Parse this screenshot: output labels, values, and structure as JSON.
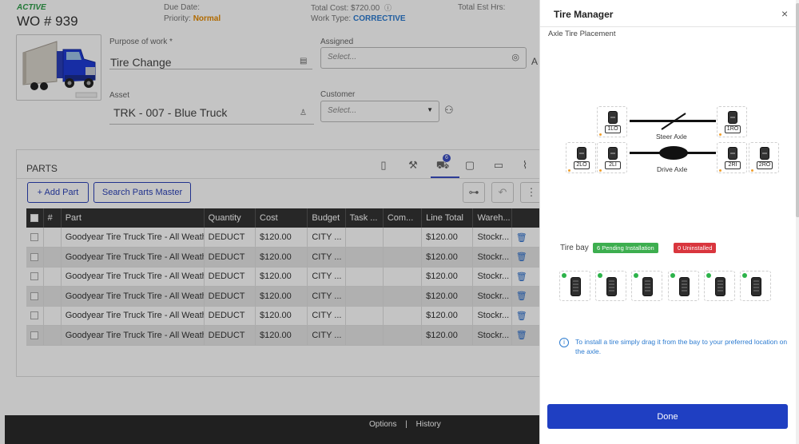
{
  "work_order": {
    "status": "ACTIVE",
    "number": "WO # 939",
    "due_date_label": "Due Date:",
    "priority_label": "Priority:",
    "priority_value": "Normal",
    "total_cost_label": "Total Cost:",
    "total_cost_value": "$720.00",
    "work_type_label": "Work Type:",
    "work_type_value": "CORRECTIVE",
    "total_est_hrs_label": "Total Est Hrs:"
  },
  "form": {
    "purpose_label": "Purpose of work *",
    "purpose_value": "Tire Change",
    "assigned_label": "Assigned",
    "assigned_placeholder": "Select...",
    "asset_label": "Asset",
    "asset_value": "TRK - 007 - Blue Truck",
    "customer_label": "Customer",
    "customer_placeholder": "Select..."
  },
  "parts": {
    "title": "PARTS",
    "cart_badge": "6",
    "add_part_label": "+ Add Part",
    "search_master_label": "Search Parts Master",
    "columns": [
      "#",
      "Part",
      "Quantity",
      "Cost",
      "Budget",
      "Task ...",
      "Com...",
      "Line Total",
      "Wareh..."
    ],
    "rows": [
      {
        "part": "Goodyear Tire Truck Tire - All Weather",
        "quantity": "DEDUCT",
        "cost": "$120.00",
        "budget": "CITY ...",
        "task": "",
        "com": "",
        "line_total": "$120.00",
        "warehouse": "Stockr..."
      },
      {
        "part": "Goodyear Tire Truck Tire - All Weather",
        "quantity": "DEDUCT",
        "cost": "$120.00",
        "budget": "CITY ...",
        "task": "",
        "com": "",
        "line_total": "$120.00",
        "warehouse": "Stockr..."
      },
      {
        "part": "Goodyear Tire Truck Tire - All Weather",
        "quantity": "DEDUCT",
        "cost": "$120.00",
        "budget": "CITY ...",
        "task": "",
        "com": "",
        "line_total": "$120.00",
        "warehouse": "Stockr..."
      },
      {
        "part": "Goodyear Tire Truck Tire - All Weather",
        "quantity": "DEDUCT",
        "cost": "$120.00",
        "budget": "CITY ...",
        "task": "",
        "com": "",
        "line_total": "$120.00",
        "warehouse": "Stockr..."
      },
      {
        "part": "Goodyear Tire Truck Tire - All Weather",
        "quantity": "DEDUCT",
        "cost": "$120.00",
        "budget": "CITY ...",
        "task": "",
        "com": "",
        "line_total": "$120.00",
        "warehouse": "Stockr..."
      },
      {
        "part": "Goodyear Tire Truck Tire - All Weather",
        "quantity": "DEDUCT",
        "cost": "$120.00",
        "budget": "CITY ...",
        "task": "",
        "com": "",
        "line_total": "$120.00",
        "warehouse": "Stockr..."
      }
    ]
  },
  "footer": {
    "options_label": "Options",
    "separator": "|",
    "history_label": "History"
  },
  "tire_manager": {
    "title": "Tire Manager",
    "close_glyph": "×",
    "subtitle": "Axle Tire Placement",
    "steer_axle_label": "Steer Axle",
    "drive_axle_label": "Drive Axle",
    "positions": [
      "1LO",
      "1RO",
      "2LO",
      "2LI",
      "2RI",
      "2RO"
    ],
    "bay_label": "Tire bay",
    "pending_badge": "6 Pending Installation",
    "uninstalled_badge": "0 Uninstalled",
    "bay_tire_count": 6,
    "info_text": "To install a tire simply drag it from the bay to your preferred location on the axle.",
    "done_label": "Done"
  },
  "colors": {
    "active_green": "#2e9e49",
    "priority_orange": "#e68a00",
    "work_type_blue": "#2c7bd0",
    "primary_blue": "#1f3fc2",
    "pending_green": "#3dae4f",
    "uninstalled_red": "#d9363e",
    "table_header": "#333333"
  }
}
